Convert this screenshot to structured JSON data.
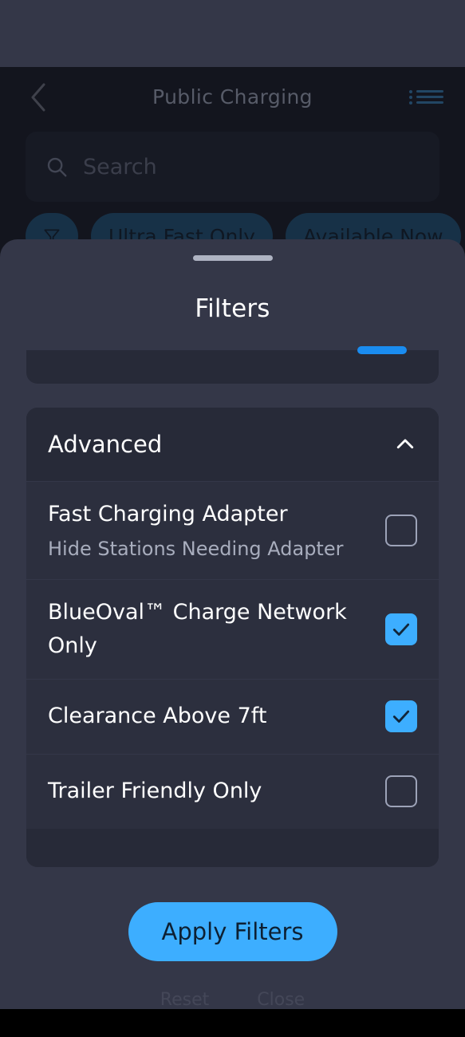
{
  "app": {
    "nav": {
      "back_icon": "chevron-left-icon",
      "title": "Public Charging",
      "list_icon": "list-view-icon"
    },
    "search": {
      "icon": "search-icon",
      "placeholder": "Search",
      "value": ""
    },
    "chips": [
      {
        "label": "",
        "icon": "filter-funnel-icon"
      },
      {
        "label": "Ultra Fast Only",
        "icon": ""
      },
      {
        "label": "Available Now",
        "icon": ""
      }
    ]
  },
  "sheet": {
    "grab_handle": "drag-handle",
    "title": "Filters",
    "section": {
      "title": "Advanced",
      "expanded": true,
      "chevron_icon": "chevron-up-icon",
      "rows": [
        {
          "label": "Fast Charging Adapter",
          "sublabel": "Hide Stations Needing Adapter",
          "checked": false
        },
        {
          "label": "BlueOval™ Charge Network Only",
          "sublabel": "",
          "checked": true
        },
        {
          "label": "Clearance Above 7ft",
          "sublabel": "",
          "checked": true
        },
        {
          "label": "Trailer Friendly Only",
          "sublabel": "",
          "checked": false
        }
      ]
    },
    "apply_button": "Apply Filters",
    "ghost_labels": [
      "Reset",
      "Close"
    ]
  },
  "colors": {
    "accent_blue": "#3DAEFF",
    "sheet_bg": "#343748",
    "card_bg": "#272a38",
    "row_bg": "#2c2f3e",
    "app_bg": "#14161f",
    "checkbox_off_border": "#9da3b8",
    "text_primary": "#ffffff",
    "text_secondary": "#a8adbd"
  }
}
